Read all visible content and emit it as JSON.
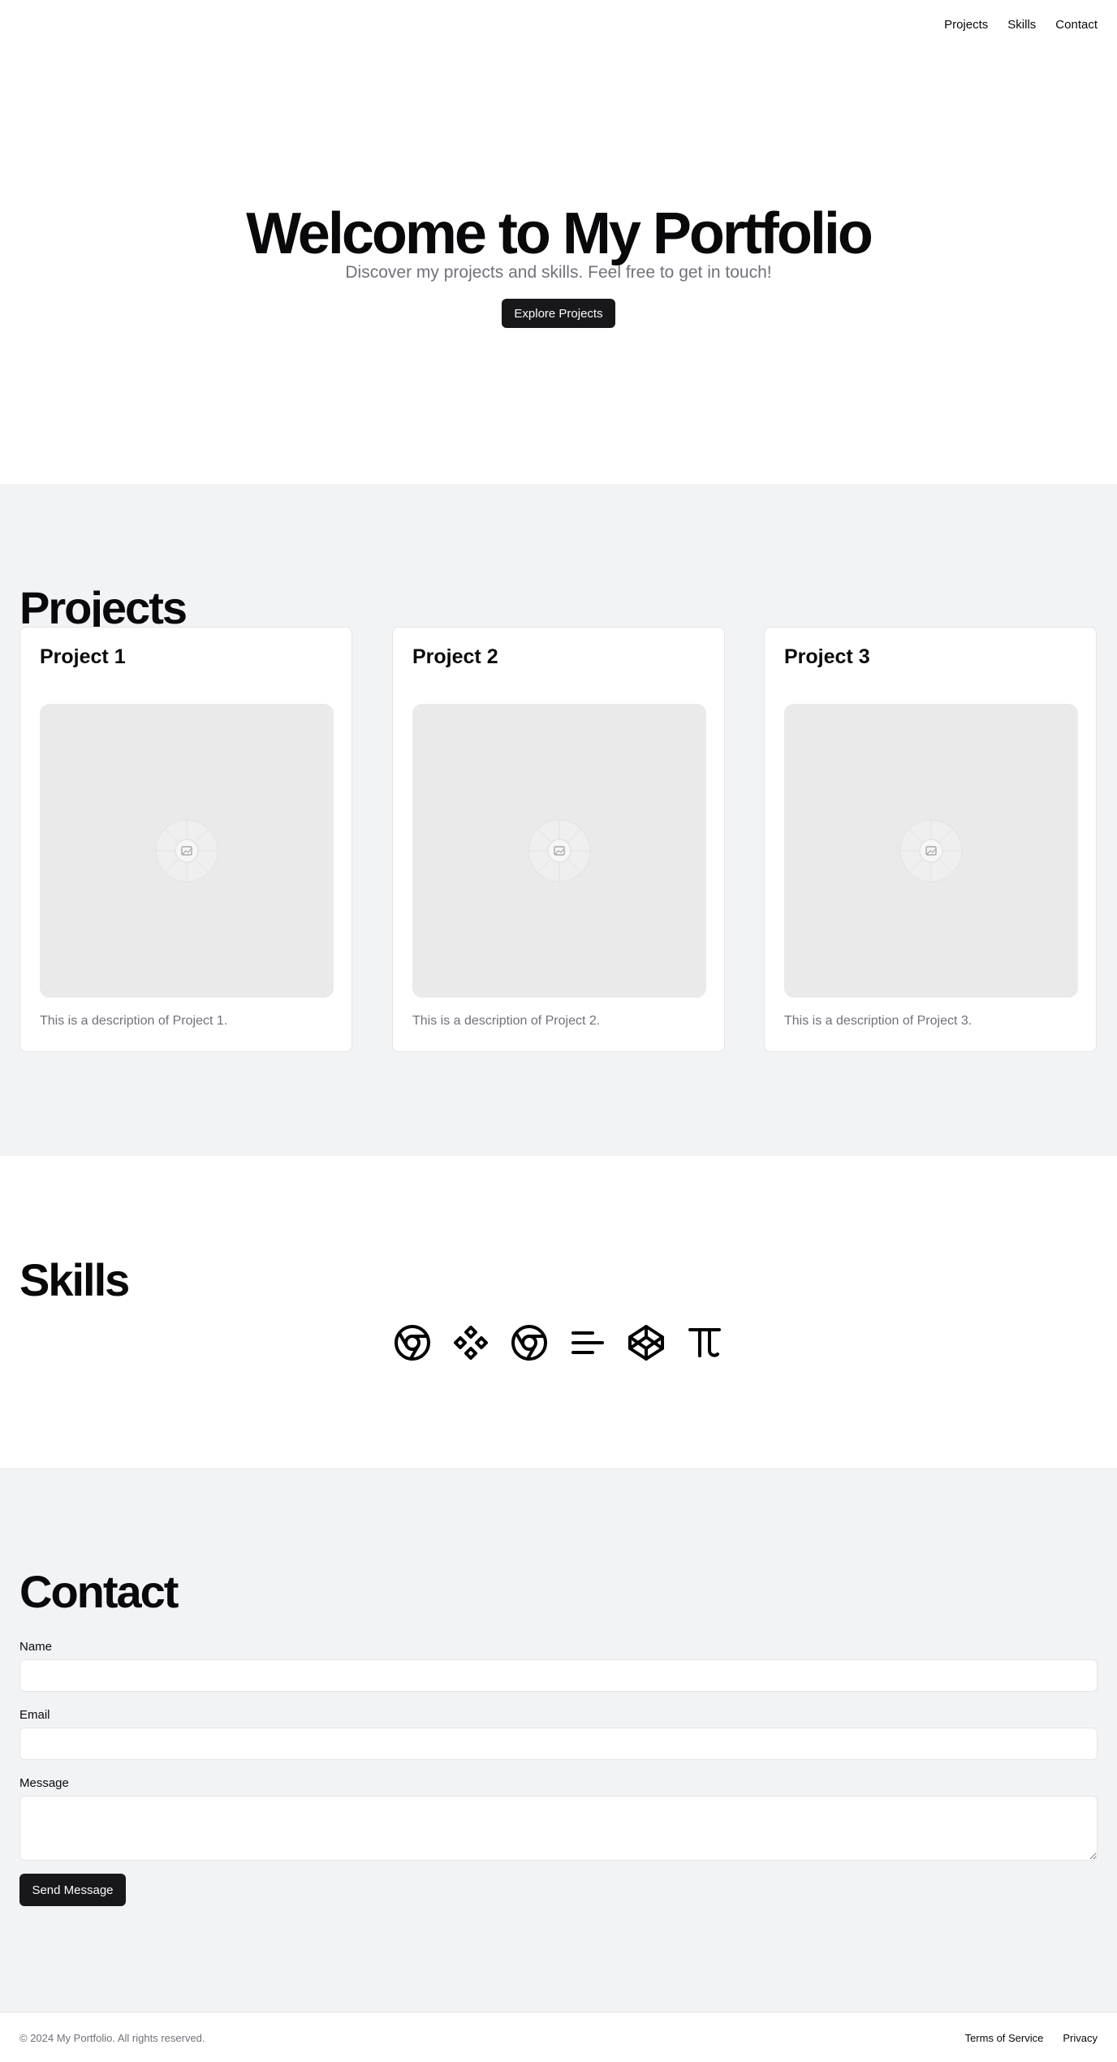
{
  "nav": {
    "items": [
      {
        "label": "Projects"
      },
      {
        "label": "Skills"
      },
      {
        "label": "Contact"
      }
    ]
  },
  "hero": {
    "title": "Welcome to My Portfolio",
    "subtitle": "Discover my projects and skills. Feel free to get in touch!",
    "cta": "Explore Projects"
  },
  "projects": {
    "title": "Projects",
    "cards": [
      {
        "title": "Project 1",
        "description": "This is a description of Project 1.",
        "image_icon": "image-placeholder-icon"
      },
      {
        "title": "Project 2",
        "description": "This is a description of Project 2.",
        "image_icon": "image-placeholder-icon"
      },
      {
        "title": "Project 3",
        "description": "This is a description of Project 3.",
        "image_icon": "image-placeholder-icon"
      }
    ]
  },
  "skills": {
    "title": "Skills",
    "icons": [
      "chrome-icon",
      "diamond-grid-icon",
      "chrome-icon",
      "align-left-icon",
      "codepen-icon",
      "pi-icon"
    ]
  },
  "contact": {
    "title": "Contact",
    "name_label": "Name",
    "email_label": "Email",
    "message_label": "Message",
    "name_value": "",
    "email_value": "",
    "message_value": "",
    "submit": "Send Message"
  },
  "footer": {
    "copyright": "© 2024 My Portfolio. All rights reserved.",
    "links": [
      {
        "label": "Terms of Service"
      },
      {
        "label": "Privacy"
      }
    ]
  },
  "colors": {
    "button_bg": "#18181b",
    "section_alt_bg": "#f2f3f5",
    "muted_text": "#71717a"
  }
}
